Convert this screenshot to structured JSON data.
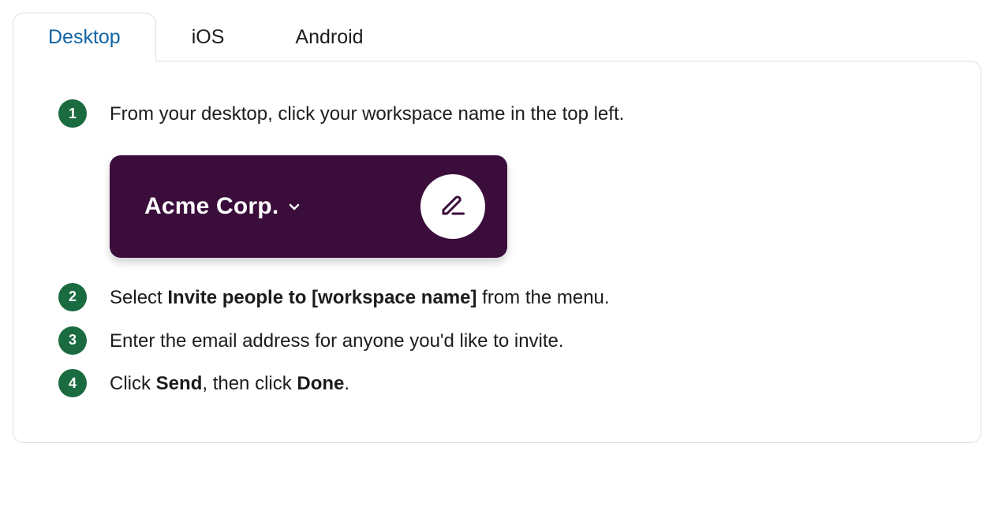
{
  "tabs": [
    {
      "label": "Desktop",
      "active": true
    },
    {
      "label": "iOS",
      "active": false
    },
    {
      "label": "Android",
      "active": false
    }
  ],
  "steps": {
    "s1": {
      "num": "1",
      "text": "From your desktop, click your workspace name in the top left."
    },
    "s2": {
      "num": "2",
      "prefix": "Select ",
      "bold": "Invite people to [workspace name]",
      "suffix": " from the menu."
    },
    "s3": {
      "num": "3",
      "text": "Enter the email address for anyone you'd like to invite."
    },
    "s4": {
      "num": "4",
      "p1": "Click ",
      "b1": "Send",
      "p2": ", then click ",
      "b2": "Done",
      "p3": "."
    }
  },
  "workspace": {
    "name": "Acme Corp."
  },
  "colors": {
    "tabActive": "#1264a3",
    "stepGreen": "#1a6b3f",
    "workspaceBg": "#3b0d3b"
  }
}
